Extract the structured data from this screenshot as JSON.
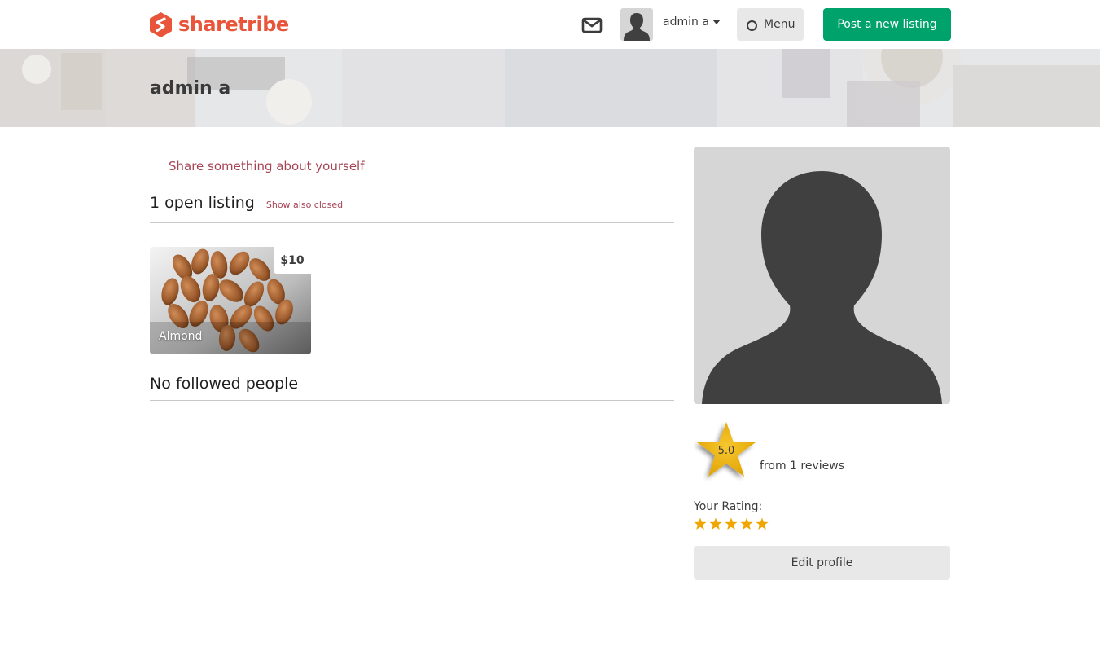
{
  "header": {
    "logo_text": "sharetribe",
    "brand_color": "#e8553a",
    "inbox_icon": "envelope-icon",
    "user_name": "admin a",
    "menu_label": "Menu",
    "post_listing_label": "Post a new listing",
    "post_button_color": "#00a26c"
  },
  "cover": {
    "title": "admin a"
  },
  "profile": {
    "share_link": "Share something about yourself",
    "listings_heading": "1 open listing",
    "show_closed_link": "Show also closed",
    "listings": [
      {
        "title": "Almond",
        "price": "$10"
      }
    ],
    "followed_heading": "No followed people"
  },
  "sidebar": {
    "rating_value": "5.0",
    "reviews_text": "from 1 reviews",
    "your_rating_label": "Your Rating:",
    "your_rating_stars": 5,
    "edit_profile_label": "Edit profile"
  }
}
